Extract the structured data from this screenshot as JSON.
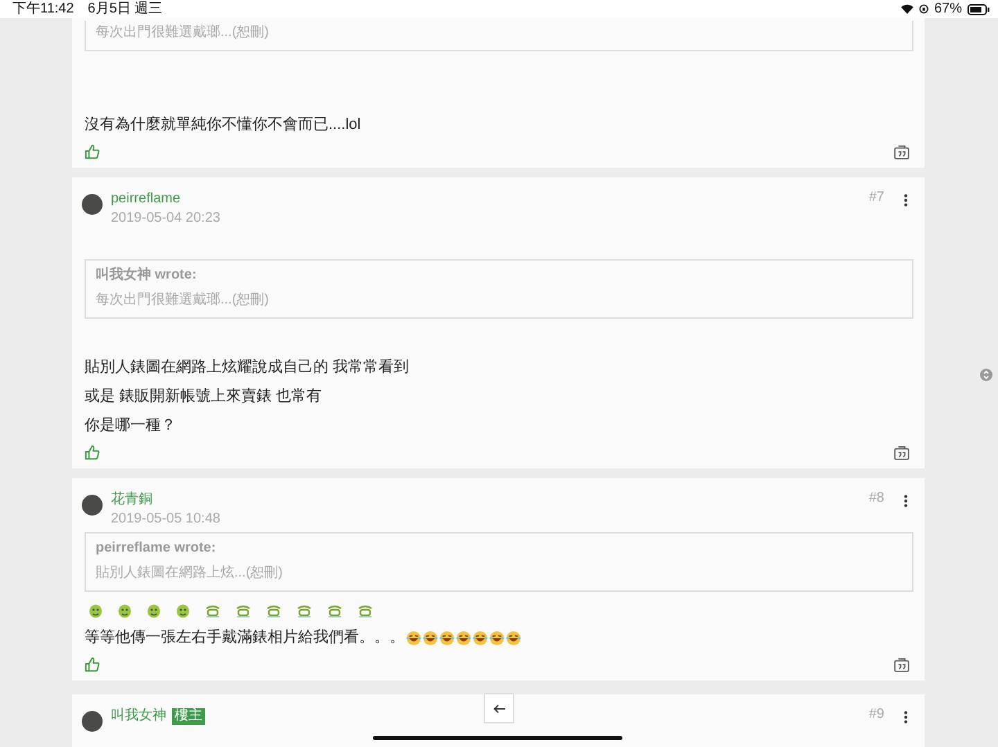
{
  "status_bar": {
    "time": "下午11:42",
    "date": "6月5日 週三",
    "battery": "67%"
  },
  "posts": [
    {
      "quote": {
        "text": "每次出門很難選戴瑯...(恕刪)"
      },
      "body": [
        "沒有為什麼就單純你不懂你不會而已....lol"
      ]
    },
    {
      "author": "peirreflame",
      "date": "2019-05-04 20:23",
      "floor": "#7",
      "quote": {
        "author": "叫我女神 wrote:",
        "text": "每次出門很難選戴瑯...(恕刪)"
      },
      "body": [
        "貼別人錶圖在網路上炫耀說成自己的 我常常看到",
        "或是 錶販開新帳號上來賣錶 也常有",
        "你是哪一種？"
      ]
    },
    {
      "author": "花青銅",
      "date": "2019-05-05 10:48",
      "floor": "#8",
      "quote": {
        "author": "peirreflame wrote:",
        "text": "貼別人錶圖在網路上炫...(恕刪)"
      },
      "stickers": [
        {
          "kind": "blob"
        },
        {
          "kind": "blob"
        },
        {
          "kind": "blob"
        },
        {
          "kind": "blob"
        },
        {
          "kind": "grin"
        },
        {
          "kind": "grin"
        },
        {
          "kind": "grin"
        },
        {
          "kind": "grin"
        },
        {
          "kind": "grin"
        },
        {
          "kind": "grin"
        }
      ],
      "body": [
        "等等他傳一張左右手戴滿錶相片給我們看。。。"
      ],
      "emoji": [
        {
          "kind": "laugh"
        },
        {
          "kind": "laugh"
        },
        {
          "kind": "laugh"
        },
        {
          "kind": "laugh"
        },
        {
          "kind": "laugh"
        },
        {
          "kind": "laugh"
        },
        {
          "kind": "laugh"
        }
      ]
    },
    {
      "author": "叫我女神",
      "badge": "樓主",
      "floor": "#9"
    }
  ]
}
